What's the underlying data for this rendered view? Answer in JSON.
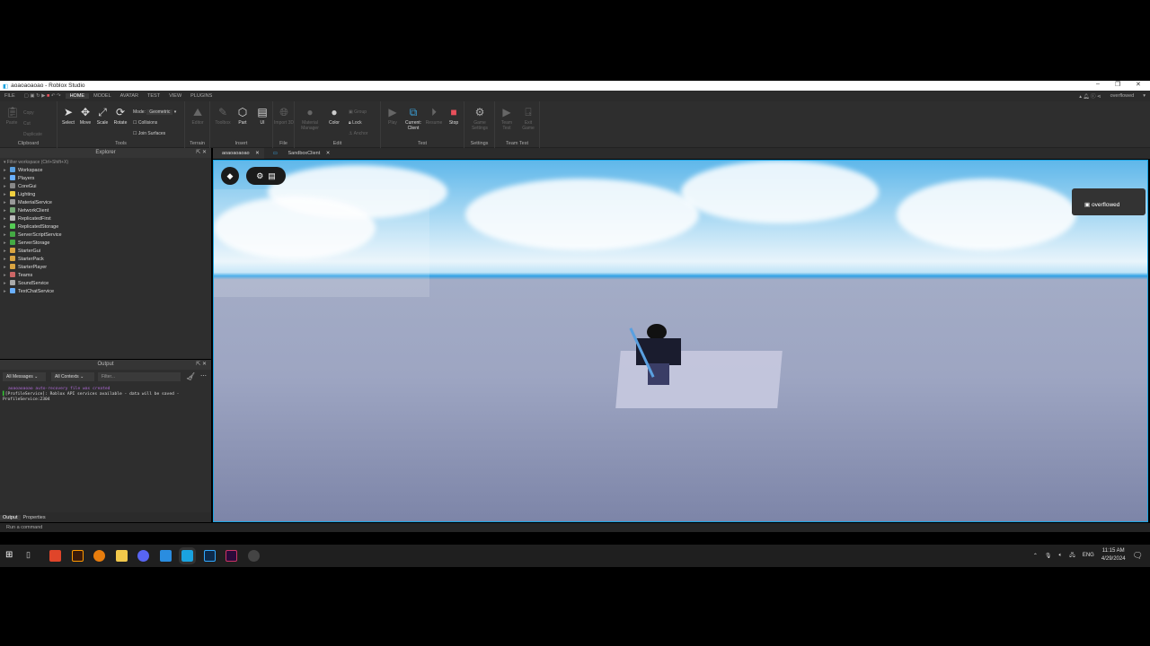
{
  "window": {
    "title": "aoaoaoaoao - Roblox Studio",
    "minimize": "–",
    "restore": "❐",
    "close": "✕"
  },
  "menu": {
    "items": [
      "FILE",
      "HOME",
      "MODEL",
      "AVATAR",
      "TEST",
      "VIEW",
      "PLUGINS"
    ],
    "active": "HOME",
    "user": "overflowed"
  },
  "ribbon": {
    "clipboard": {
      "label": "Clipboard",
      "paste": "Paste",
      "copy": "Copy",
      "cut": "Cut",
      "duplicate": "Duplicate"
    },
    "tools": {
      "label": "Tools",
      "select": "Select",
      "move": "Move",
      "scale": "Scale",
      "rotate": "Rotate",
      "mode_label": "Mode:",
      "mode_value": "Geometric",
      "collisions": "Collisions",
      "join_surfaces": "Join Surfaces"
    },
    "terrain": {
      "label": "Terrain",
      "editor": "Editor"
    },
    "insert": {
      "label": "Insert",
      "toolbox": "Toolbox",
      "part": "Part",
      "ui": "UI"
    },
    "file": {
      "label": "File",
      "import3d": "Import 3D"
    },
    "edit": {
      "label": "Edit",
      "material": "Material Manager",
      "color": "Color",
      "group": "Group",
      "lock": "Lock",
      "anchor": "Anchor"
    },
    "test": {
      "label": "Test",
      "play": "Play",
      "current_client": "Current: Client",
      "resume": "Resume",
      "stop": "Stop"
    },
    "settings": {
      "label": "Settings",
      "game_settings": "Game Settings"
    },
    "team_test": {
      "label": "Team Test",
      "team_test": "Team Test",
      "exit_game": "Exit Game"
    }
  },
  "explorer": {
    "title": "Explorer",
    "filter_placeholder": "Filter workspace (Ctrl+Shift+X)",
    "items": [
      "Workspace",
      "Players",
      "CoreGui",
      "Lighting",
      "MaterialService",
      "NetworkClient",
      "ReplicatedFirst",
      "ReplicatedStorage",
      "ServerScriptService",
      "ServerStorage",
      "StarterGui",
      "StarterPack",
      "StarterPlayer",
      "Teams",
      "SoundService",
      "TextChatService"
    ]
  },
  "output": {
    "title": "Output",
    "messages_filter": "All Messages",
    "contexts_filter": "All Contexts",
    "filter_placeholder": "Filter...",
    "lines": [
      "aoaoaoaoao auto-recovery file was created",
      "[ProfileService]: Roblox API services available - data will be saved -",
      "ProfileService:2304"
    ]
  },
  "bottom_tabs": [
    "Output",
    "Properties"
  ],
  "command_placeholder": "Run a command",
  "doc_tabs": [
    "aoaoaoaoao",
    "SandboxClient"
  ],
  "viewport": {
    "notification": "overflowed"
  },
  "taskbar": {
    "time": "11:15 AM",
    "date": "4/29/2024",
    "lang": "ENG"
  },
  "colors": {
    "accent": "#1aa3e0",
    "stop": "#e8505b",
    "log_purple": "#b06ad8"
  }
}
